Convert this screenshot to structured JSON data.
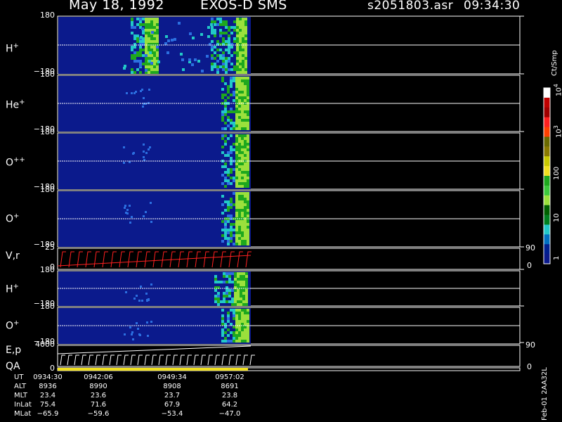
{
  "header": {
    "date": "May 18, 1992",
    "instrument": "EXOS-D SMS",
    "file": "s2051803.asr",
    "time": "09:34:30"
  },
  "colors": {
    "panel_background": "#0b1a8c",
    "green": "#1ea81e",
    "light_green": "#9be03c",
    "cyan": "#22c8c8",
    "red_trace": "#ff2020",
    "qa_bar": "#f0e020"
  },
  "panels": [
    {
      "label": "H",
      "sup": "+",
      "ytop": "180",
      "ybot": "−180"
    },
    {
      "label": "He",
      "sup": "+",
      "ytop": "180",
      "ybot": "−180"
    },
    {
      "label": "O",
      "sup": "++",
      "ytop": "180",
      "ybot": "−180"
    },
    {
      "label": "O",
      "sup": "+",
      "ytop": "180",
      "ybot": "−180"
    },
    {
      "label": "V,r",
      "sup": "",
      "ytop": "25",
      "ybot": "0",
      "rtop": "90",
      "rbot": "0"
    },
    {
      "label": "H",
      "sup": "+",
      "ytop": "180",
      "ybot": "−180"
    },
    {
      "label": "O",
      "sup": "+",
      "ytop": "180",
      "ybot": "−180"
    },
    {
      "label": "E,p",
      "sup": "",
      "ytop": "4000",
      "ybot": "",
      "rtop": "90",
      "rbot": ""
    },
    {
      "label": "QA",
      "sup": "",
      "ytop": "",
      "ybot": "0",
      "rtop": "",
      "rbot": "0"
    }
  ],
  "colorbar": {
    "title": "Ct/Smp",
    "ticks": [
      {
        "main": "1",
        "sup": ""
      },
      {
        "main": "10",
        "sup": ""
      },
      {
        "main": "100",
        "sup": ""
      },
      {
        "main": "10",
        "sup": "3"
      },
      {
        "main": "10",
        "sup": "4"
      }
    ]
  },
  "footer": {
    "row_labels": [
      "UT",
      "ALT",
      "MLT",
      "InLat",
      "MLat"
    ],
    "columns": [
      [
        "0934:30",
        "8936",
        "23.4",
        "75.4",
        "−65.9"
      ],
      [
        "0942:06",
        "8990",
        "23.6",
        "71.6",
        "−59.6"
      ],
      [
        "0949:34",
        "8908",
        "23.7",
        "67.9",
        "−53.4"
      ],
      [
        "0957:02",
        "8691",
        "23.8",
        "64.2",
        "−47.0"
      ]
    ],
    "side_note": "Feb-01 2AA32L"
  },
  "chart_data": {
    "type": "heatmap",
    "x_ticks": [
      "0934:30",
      "0942:06",
      "0949:34",
      "0957:02"
    ],
    "y_range": [
      -180,
      180
    ],
    "colorbar_range": [
      1,
      10000
    ],
    "colorbar_scale": "log",
    "panels": [
      "H+",
      "He+",
      "O++",
      "O+",
      "V,r",
      "H+",
      "O+",
      "E,p",
      "QA"
    ]
  }
}
